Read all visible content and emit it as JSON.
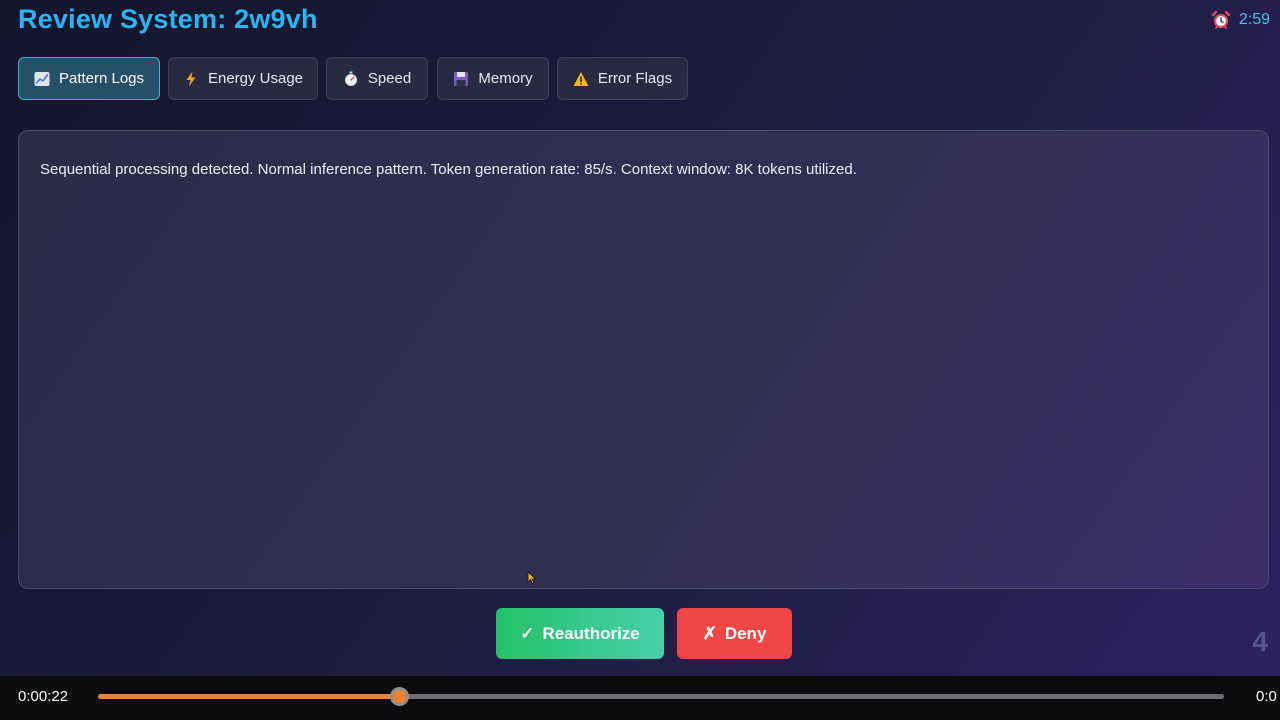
{
  "header": {
    "title": "Review System: 2w9vh",
    "timer": "2:59",
    "timer_icon": "alarm-clock-icon"
  },
  "tabs": [
    {
      "label": "Pattern Logs",
      "icon": "chart-icon",
      "active": true
    },
    {
      "label": "Energy Usage",
      "icon": "lightning-icon",
      "active": false
    },
    {
      "label": "Speed",
      "icon": "stopwatch-icon",
      "active": false
    },
    {
      "label": "Memory",
      "icon": "floppy-disk-icon",
      "active": false
    },
    {
      "label": "Error Flags",
      "icon": "warning-icon",
      "active": false
    }
  ],
  "panel": {
    "text": "Sequential processing detected. Normal inference pattern. Token generation rate: 85/s. Context window: 8K tokens utilized."
  },
  "actions": {
    "reauthorize": {
      "icon": "✓",
      "label": "Reauthorize"
    },
    "deny": {
      "icon": "✗",
      "label": "Deny"
    }
  },
  "page_number": "4",
  "player": {
    "current_time": "0:00:22",
    "end_time": "0:0",
    "progress_fraction": 0.267
  },
  "colors": {
    "accent": "#2bb4f2",
    "approve": "#22c26a",
    "deny": "#f04646",
    "progress": "#f0802a"
  }
}
